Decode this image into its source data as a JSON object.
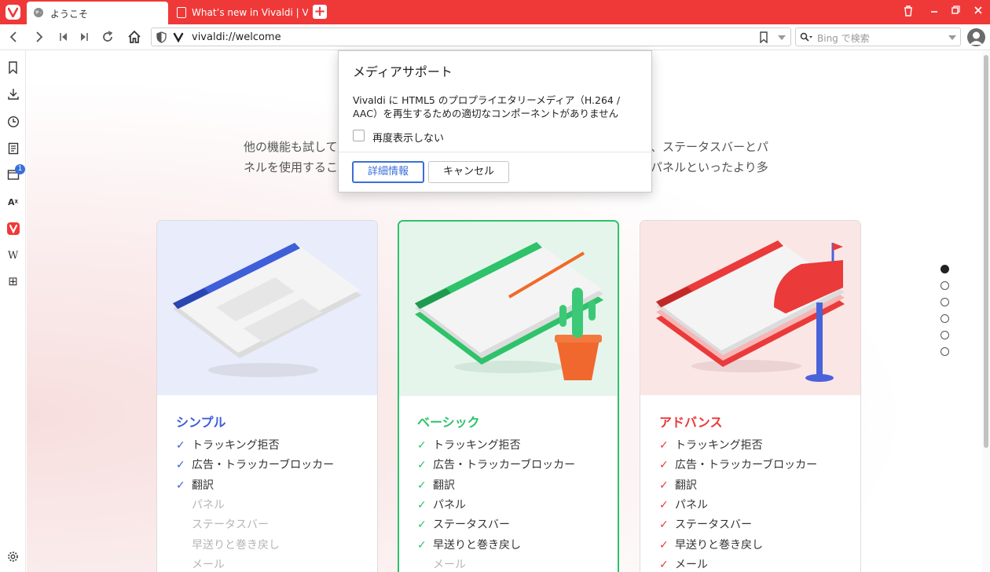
{
  "tabs": [
    {
      "title": "ようこそ",
      "active": true
    },
    {
      "title": "What’s new in Vivaldi | Viva",
      "active": false
    }
  ],
  "address_bar": {
    "url": "vivaldi://welcome"
  },
  "search": {
    "placeholder": "Bing で検索"
  },
  "side_panel": {
    "items": [
      {
        "icon": "bookmark-icon"
      },
      {
        "icon": "download-icon"
      },
      {
        "icon": "history-icon"
      },
      {
        "icon": "notes-icon"
      },
      {
        "icon": "window-panel-icon",
        "badge": "1"
      },
      {
        "icon": "translate-icon",
        "label": "Aᵡ"
      },
      {
        "icon": "vivaldi-icon"
      },
      {
        "icon": "wikipedia-icon",
        "label": "W"
      },
      {
        "icon": "add-panel-icon",
        "label": "⊞"
      }
    ]
  },
  "intro": {
    "line1_left": "他の機能も試して",
    "line1_right": "、ステータスバーとパ",
    "line2_left": "ネルを使用するこ",
    "line2_right": "パネルといったより多"
  },
  "dialog": {
    "title": "メディアサポート",
    "message": "Vivaldi に HTML5 のプロプライエタリーメディア（H.264 / AAC）を再生するための適切なコンポーネントがありません",
    "checkbox_label": "再度表示しない",
    "checkbox_checked": false,
    "primary_button": "詳細情報",
    "secondary_button": "キャンセル"
  },
  "cards": [
    {
      "name": "シンプル",
      "accent": "#3f5fd9",
      "features": [
        {
          "label": "トラッキング拒否",
          "enabled": true
        },
        {
          "label": "広告・トラッカーブロッカー",
          "enabled": true
        },
        {
          "label": "翻訳",
          "enabled": true
        },
        {
          "label": "パネル",
          "enabled": false
        },
        {
          "label": "ステータスバー",
          "enabled": false
        },
        {
          "label": "早送りと巻き戻し",
          "enabled": false
        },
        {
          "label": "メール",
          "enabled": false
        }
      ]
    },
    {
      "name": "ベーシック",
      "accent": "#2ec26a",
      "selected": true,
      "features": [
        {
          "label": "トラッキング拒否",
          "enabled": true
        },
        {
          "label": "広告・トラッカーブロッカー",
          "enabled": true
        },
        {
          "label": "翻訳",
          "enabled": true
        },
        {
          "label": "パネル",
          "enabled": true
        },
        {
          "label": "ステータスバー",
          "enabled": true
        },
        {
          "label": "早送りと巻き戻し",
          "enabled": true
        },
        {
          "label": "メール",
          "enabled": false
        }
      ]
    },
    {
      "name": "アドバンス",
      "accent": "#ea3a3a",
      "features": [
        {
          "label": "トラッキング拒否",
          "enabled": true
        },
        {
          "label": "広告・トラッカーブロッカー",
          "enabled": true
        },
        {
          "label": "翻訳",
          "enabled": true
        },
        {
          "label": "パネル",
          "enabled": true
        },
        {
          "label": "ステータスバー",
          "enabled": true
        },
        {
          "label": "早送りと巻き戻し",
          "enabled": true
        },
        {
          "label": "メール",
          "enabled": true
        }
      ]
    }
  ],
  "check_mark": "✓",
  "page_dots": {
    "count": 6,
    "active_index": 0
  },
  "colors": {
    "brand_red": "#ef3939",
    "link_blue": "#3a6fd8"
  }
}
